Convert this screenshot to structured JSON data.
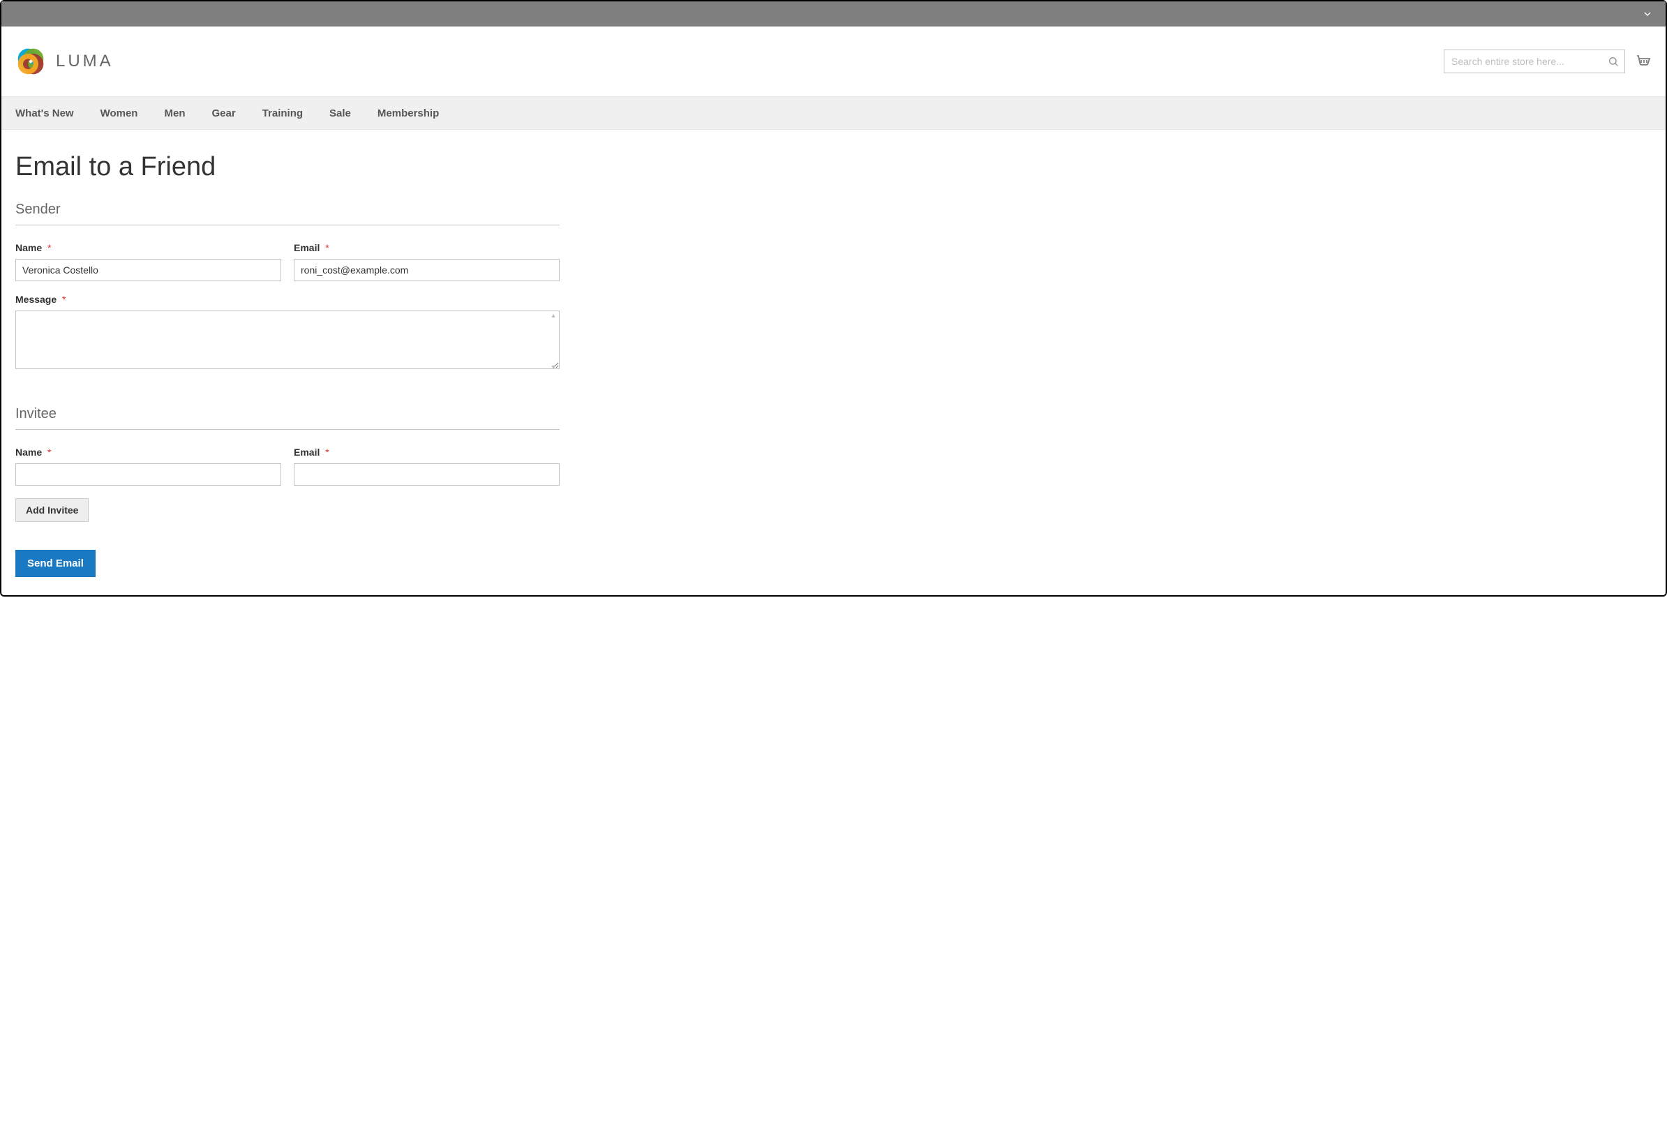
{
  "header": {
    "logo_text": "LUMA",
    "search_placeholder": "Search entire store here..."
  },
  "nav": {
    "items": [
      {
        "label": "What's New"
      },
      {
        "label": "Women"
      },
      {
        "label": "Men"
      },
      {
        "label": "Gear"
      },
      {
        "label": "Training"
      },
      {
        "label": "Sale"
      },
      {
        "label": "Membership"
      }
    ]
  },
  "page": {
    "title": "Email to a Friend"
  },
  "form": {
    "sender": {
      "legend": "Sender",
      "name_label": "Name",
      "name_value": "Veronica Costello",
      "email_label": "Email",
      "email_value": "roni_cost@example.com",
      "message_label": "Message",
      "message_value": ""
    },
    "invitee": {
      "legend": "Invitee",
      "name_label": "Name",
      "name_value": "",
      "email_label": "Email",
      "email_value": ""
    },
    "required_mark": "*",
    "add_invitee_label": "Add Invitee",
    "send_email_label": "Send Email"
  }
}
